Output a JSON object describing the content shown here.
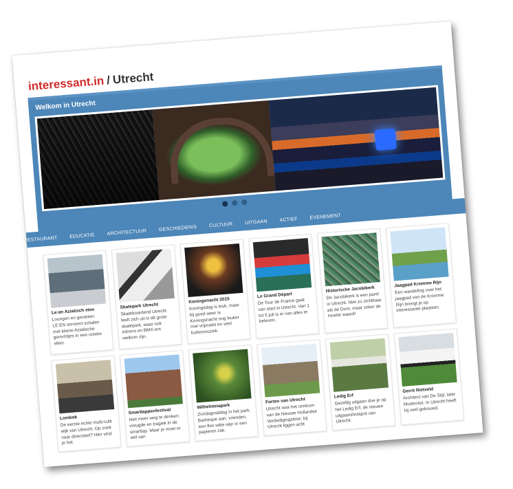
{
  "brand": {
    "site": "interessant.in",
    "separator": "/",
    "city": "Utrecht"
  },
  "hero": {
    "title": "Welkom in Utrecht",
    "slide_count": 3,
    "active_slide": 1
  },
  "nav": [
    "RESTAURANT",
    "EDUCATIE",
    "ARCHITECTUUR",
    "GESCHIEDENIS",
    "CULTUUR",
    "UITGAAN",
    "ACTIEF",
    "EVENEMENT"
  ],
  "cards_row1": [
    {
      "title": "Le:an Aziatisch eten",
      "text": "Loungen en genieten: LE:EN serveert schalen met kleine Aziatische gerechtjes in een unieke sfeer."
    },
    {
      "title": "Skatepark Utrecht",
      "text": "Skateboardend Utrecht leeft zich uit in dit grote skatepark, waar ook inliners en BMX-ers welkom zijn."
    },
    {
      "title": "Koningsnacht 2015",
      "text": "Koningsdag is leuk, maar bij goed weer is Koningsnacht nog leuker met vrijmarkt en veel buitenmuziek."
    },
    {
      "title": "Le Grand Départ",
      "text": "De Tour de France gaat van start in Utrecht. Van 1 tot 5 juli is er van alles te beleven."
    },
    {
      "title": "Historische Jacobikerk",
      "text": "De Jacobikerk is een parel in Utrecht. Niet zo zichtbaar als de Dom, maar zeker de moeite waard!"
    },
    {
      "title": "Jaagpad Kromme Rijn",
      "text": "Een wandeling over het jaagpad van de Kromme Rijn brengt je op interessante plaatsen."
    }
  ],
  "cards_row2": [
    {
      "title": "Lombok",
      "text": "De eerste echte multi-culti wijk van Utrecht. Op zoek naar diversiteit? Hier vind je het."
    },
    {
      "title": "Smartlappenfestival",
      "text": "Niet meer weg te denken: vreugde en tragiek in de smartlap. Maar je moet er wel van"
    },
    {
      "title": "Wilhelminapark",
      "text": "Zondagmiddag in het park. Barbeque aan, vrienden, een fles witte wijn in een papieren zak."
    },
    {
      "title": "Forten van Utrecht",
      "text": "Utrecht was het centrum van de Nieuwe Hollandse Verdedigingslinie: bij Utrecht liggen acht"
    },
    {
      "title": "Ledig Erf",
      "text": "Gezellig uitgaan doe je op het Ledig Erf, de nieuwe uitgaanshotspot van Utrecht."
    },
    {
      "title": "Gerrit Rietveld",
      "text": "Architect van De Stijl, later Modernist. In Utrecht heeft hij veel gebouwd."
    }
  ]
}
